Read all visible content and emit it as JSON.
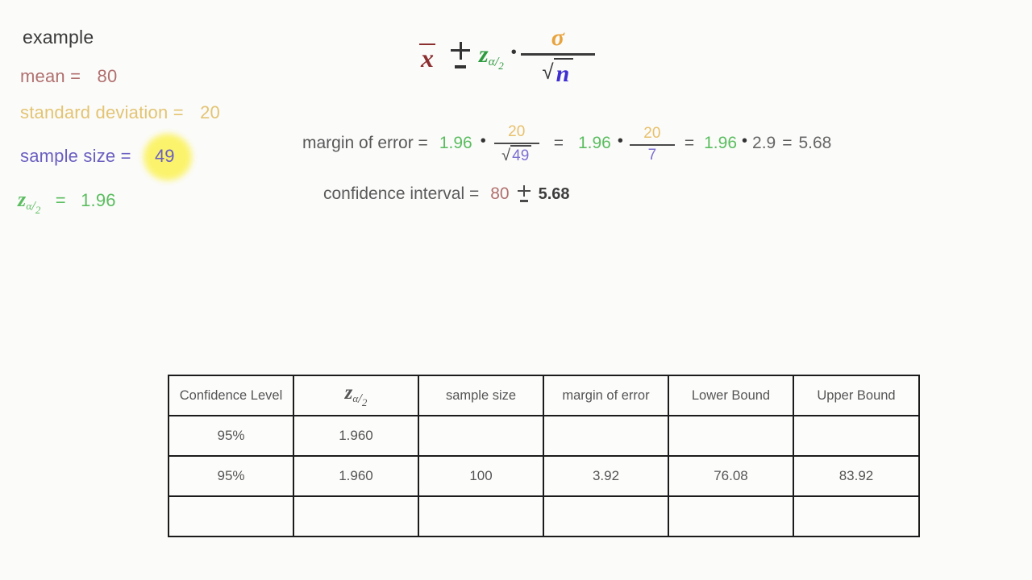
{
  "page": {
    "background_color": "#fbfbfa",
    "title": "example"
  },
  "left_panel": {
    "title": "example",
    "mean_label": "mean = ",
    "mean_value": "80",
    "mean_color": "#b0706e",
    "sd_label": "standard deviation = ",
    "sd_value": "20",
    "sd_color": "#e3c472",
    "sample_size_label": "sample size = ",
    "sample_size_value": "49",
    "sample_size_color": "#6a5fc0",
    "sample_size_highlight_color": "#fbf364",
    "z_label_symbol": "z",
    "z_label_sub_alpha": "α",
    "z_label_sub_slash": "/",
    "z_label_sub_two": "2",
    "z_equals": "=",
    "z_value": "1.96",
    "z_color": "#5bbd5f"
  },
  "main_formula": {
    "xbar": "x",
    "plus_minus": "±",
    "z_symbol": "z",
    "z_sub_alpha": "α",
    "z_sub_slash": "/",
    "z_sub_two": "2",
    "multiply_dot": "•",
    "numerator_sigma": "σ",
    "sqrt_radical": "√",
    "denominator_n": "n",
    "sigma_color": "#e8a33d",
    "n_color": "#3f2fd0",
    "z_color": "#2f9b3f",
    "xbar_color": "#8c2f2f"
  },
  "margin_of_error_row": {
    "label": "margin of error =",
    "z_value": "1.96",
    "dot1": "•",
    "num1": "20",
    "sqrt": "√",
    "den1": "49",
    "eq1": "=",
    "z_value2": "1.96",
    "dot2": "•",
    "num2": "20",
    "den2": "7",
    "eq2": "=",
    "z_value3": "1.96",
    "dot3": "•",
    "factor": "2.9",
    "eq3": "=",
    "result": "5.68"
  },
  "confidence_interval_row": {
    "label": "confidence interval =",
    "mean": "80",
    "plus_minus": "±",
    "margin": "5.68"
  },
  "table": {
    "headers": [
      "Confidence Level",
      "z",
      "sample size",
      "margin of error",
      "Lower Bound",
      "Upper Bound"
    ],
    "header_z_sub_alpha": "α",
    "header_z_sub_slash": "/",
    "header_z_sub_two": "2",
    "rows": [
      {
        "confidence_level": "95%",
        "z": "1.960",
        "sample_size": "",
        "margin_of_error": "",
        "lower_bound": "",
        "upper_bound": ""
      },
      {
        "confidence_level": "95%",
        "z": "1.960",
        "sample_size": "100",
        "margin_of_error": "3.92",
        "lower_bound": "76.08",
        "upper_bound": "83.92"
      },
      {
        "confidence_level": "",
        "z": "",
        "sample_size": "",
        "margin_of_error": "",
        "lower_bound": "",
        "upper_bound": ""
      }
    ]
  }
}
